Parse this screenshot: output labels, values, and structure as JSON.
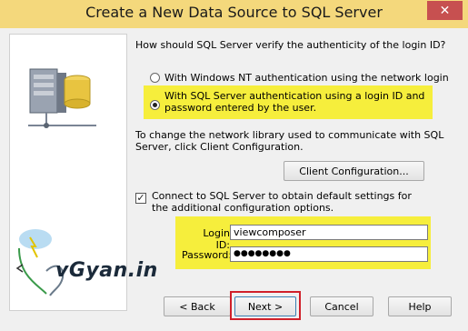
{
  "window": {
    "title": "Create a New Data Source to SQL Server",
    "close_glyph": "✕"
  },
  "question": "How should SQL Server verify the authenticity of the login ID?",
  "auth_options": [
    {
      "label": "With Windows NT authentication using the network login ID.",
      "selected": false
    },
    {
      "label": "With SQL Server authentication using a login ID and password entered by the user.",
      "selected": true
    }
  ],
  "network_text": "To change the network library used to communicate with SQL Server, click Client Configuration.",
  "client_config_button": "Client Configuration...",
  "connect_checkbox": {
    "label": "Connect to SQL Server to obtain default settings for the additional configuration options.",
    "checked": true
  },
  "login_id": {
    "label": "Login ID:",
    "value": "viewcomposer"
  },
  "password": {
    "label": "Password:",
    "value": "●●●●●●●●"
  },
  "watermark": {
    "text": "vGyan.in"
  },
  "buttons": {
    "back": "< Back",
    "next": "Next >",
    "cancel": "Cancel",
    "help": "Help"
  },
  "colors": {
    "highlight": "#f6ee3c",
    "next_outline": "#d0202a",
    "titlebar": "#f4d87c"
  }
}
